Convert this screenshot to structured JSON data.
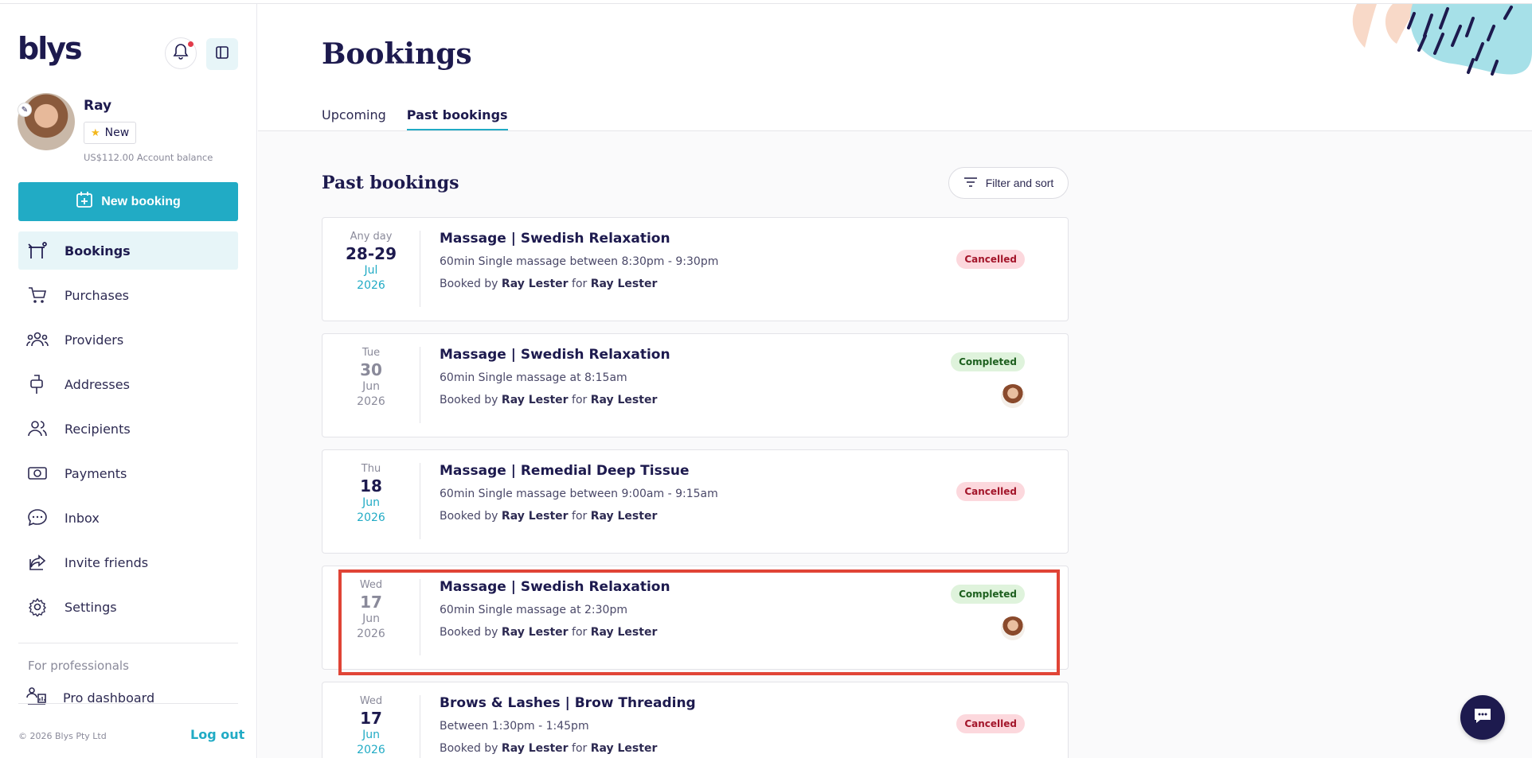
{
  "brand": {
    "logo_text": "blys",
    "accent": "#21abc5",
    "navy": "#1d1a4e"
  },
  "user": {
    "name": "Ray",
    "badge": "New",
    "balance": "US$112.00 Account balance"
  },
  "sidebar": {
    "new_booking_label": "New booking",
    "items": [
      {
        "label": "Bookings",
        "icon": "massage-table-icon",
        "active": true
      },
      {
        "label": "Purchases",
        "icon": "cart-icon"
      },
      {
        "label": "Providers",
        "icon": "group-icon"
      },
      {
        "label": "Addresses",
        "icon": "mailbox-icon"
      },
      {
        "label": "Recipients",
        "icon": "users-icon"
      },
      {
        "label": "Payments",
        "icon": "cash-icon"
      },
      {
        "label": "Inbox",
        "icon": "chat-bubble-icon"
      },
      {
        "label": "Invite friends",
        "icon": "share-icon"
      },
      {
        "label": "Settings",
        "icon": "gear-icon"
      }
    ],
    "for_professionals": "For professionals",
    "pro_dashboard": "Pro dashboard",
    "copyright": "© 2026 Blys Pty Ltd",
    "logout": "Log out"
  },
  "main": {
    "title": "Bookings",
    "tabs": [
      {
        "label": "Upcoming",
        "active": false
      },
      {
        "label": "Past bookings",
        "active": true
      }
    ],
    "section_title": "Past bookings",
    "filter_label": "Filter and sort"
  },
  "bookings": [
    {
      "dow": "Any day",
      "day": "28-29",
      "month": "Jul",
      "year": "2026",
      "title": "Massage | Swedish Relaxation",
      "detail": "60min Single massage between 8:30pm - 9:30pm",
      "booked_by_prefix": "Booked by",
      "booked_by": "Ray Lester",
      "for_word": "for",
      "recipient": "Ray Lester",
      "status": "Cancelled"
    },
    {
      "dow": "Tue",
      "day": "30",
      "month": "Jun",
      "year": "2026",
      "title": "Massage | Swedish Relaxation",
      "detail": "60min Single massage at 8:15am",
      "booked_by_prefix": "Booked by",
      "booked_by": "Ray Lester",
      "for_word": "for",
      "recipient": "Ray Lester",
      "status": "Completed"
    },
    {
      "dow": "Thu",
      "day": "18",
      "month": "Jun",
      "year": "2026",
      "title": "Massage | Remedial Deep Tissue",
      "detail": "60min Single massage between 9:00am - 9:15am",
      "booked_by_prefix": "Booked by",
      "booked_by": "Ray Lester",
      "for_word": "for",
      "recipient": "Ray Lester",
      "status": "Cancelled"
    },
    {
      "dow": "Wed",
      "day": "17",
      "month": "Jun",
      "year": "2026",
      "title": "Massage | Swedish Relaxation",
      "detail": "60min Single massage at 2:30pm",
      "booked_by_prefix": "Booked by",
      "booked_by": "Ray Lester",
      "for_word": "for",
      "recipient": "Ray Lester",
      "status": "Completed"
    },
    {
      "dow": "Wed",
      "day": "17",
      "month": "Jun",
      "year": "2026",
      "title": "Brows & Lashes | Brow Threading",
      "detail": "Between 1:30pm - 1:45pm",
      "booked_by_prefix": "Booked by",
      "booked_by": "Ray Lester",
      "for_word": "for",
      "recipient": "Ray Lester",
      "status": "Cancelled"
    }
  ]
}
